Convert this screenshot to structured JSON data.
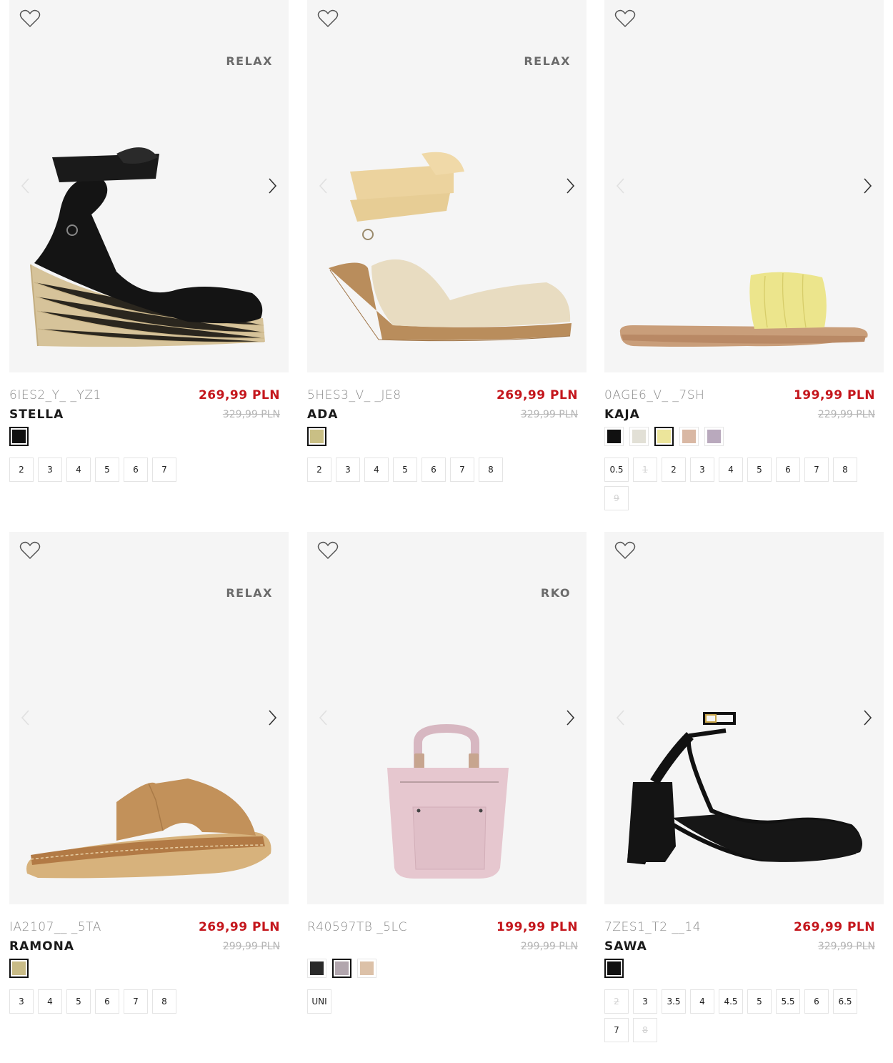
{
  "products": [
    {
      "sku": "6IES2_Y_ _YZ1",
      "name": "STELLA",
      "price": "269,99 PLN",
      "old_price": "329,99 PLN",
      "badge": "RELAX",
      "colors": [
        {
          "hex": "#111111",
          "selected": true
        }
      ],
      "sizes": [
        "2",
        "3",
        "4",
        "5",
        "6",
        "7"
      ]
    },
    {
      "sku": "5HES3_V_ _JE8",
      "name": "ADA",
      "price": "269,99 PLN",
      "old_price": "329,99 PLN",
      "badge": "RELAX",
      "colors": [
        {
          "hex": "#c9bf85",
          "selected": true
        }
      ],
      "sizes": [
        "2",
        "3",
        "4",
        "5",
        "6",
        "7",
        "8"
      ]
    },
    {
      "sku": "0AGE6_V_ _7SH",
      "name": "KAJA",
      "price": "199,99 PLN",
      "old_price": "229,99 PLN",
      "badge": "",
      "colors": [
        {
          "hex": "#111111",
          "selected": false
        },
        {
          "hex": "#e2e0d6",
          "selected": false
        },
        {
          "hex": "#ece59b",
          "selected": true
        },
        {
          "hex": "#d9b8a4",
          "selected": false
        },
        {
          "hex": "#b9a9bd",
          "selected": false
        }
      ],
      "sizes": [
        "0.5",
        "1",
        "2",
        "3",
        "4",
        "5",
        "6",
        "7",
        "8",
        "9"
      ],
      "unavailable": [
        "1",
        "9"
      ]
    },
    {
      "sku": "IA2107__ _5TA",
      "name": "RAMONA",
      "price": "269,99 PLN",
      "old_price": "299,99 PLN",
      "badge": "RELAX",
      "colors": [
        {
          "hex": "#c8bb86",
          "selected": true
        }
      ],
      "sizes": [
        "3",
        "4",
        "5",
        "6",
        "7",
        "8"
      ]
    },
    {
      "sku": "R40597TB _5LC",
      "name": "",
      "price": "199,99 PLN",
      "old_price": "299,99 PLN",
      "badge": "RKO",
      "colors": [
        {
          "hex": "#2a2a2a",
          "selected": false
        },
        {
          "hex": "#b2a6ae",
          "selected": true
        },
        {
          "hex": "#dcc1a8",
          "selected": false
        }
      ],
      "sizes": [
        "UNI"
      ]
    },
    {
      "sku": "7ZES1_T2 __14",
      "name": "SAWA",
      "price": "269,99 PLN",
      "old_price": "329,99 PLN",
      "badge": "",
      "colors": [
        {
          "hex": "#111111",
          "selected": true
        }
      ],
      "sizes": [
        "2",
        "3",
        "3.5",
        "4",
        "4.5",
        "5",
        "5.5",
        "6",
        "6.5",
        "7",
        "8"
      ],
      "unavailable": [
        "2",
        "8"
      ]
    }
  ],
  "icons": {
    "favorite": "heart-icon",
    "prev": "chevron-left-icon",
    "next": "chevron-right-icon"
  }
}
